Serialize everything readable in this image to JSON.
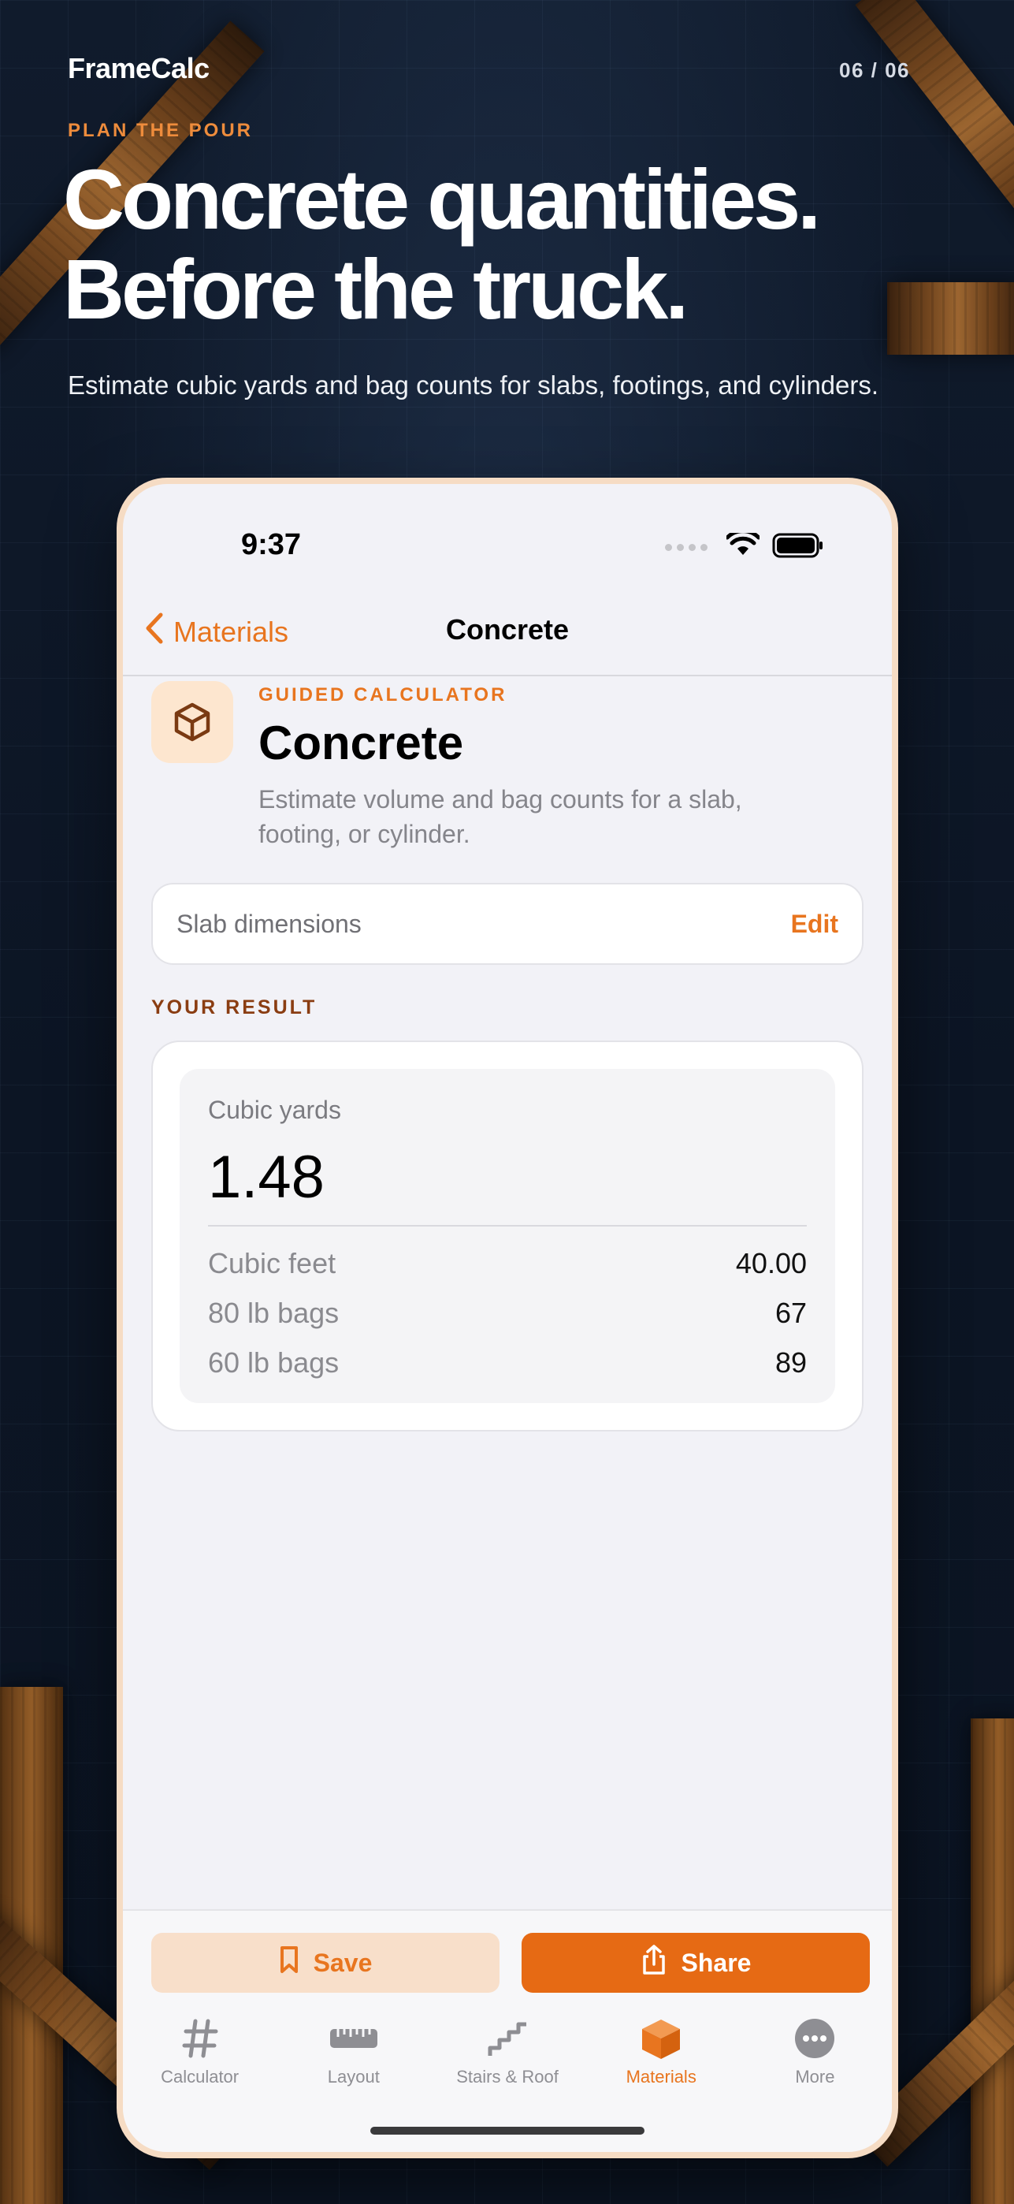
{
  "promo": {
    "brand": "FrameCalc",
    "counter": "06 / 06",
    "eyebrow": "PLAN THE POUR",
    "headline_line1": "Concrete quantities.",
    "headline_line2": "Before the truck.",
    "subline": "Estimate cubic yards and bag counts for slabs, footings, and cylinders."
  },
  "status_bar": {
    "time": "9:37"
  },
  "nav": {
    "back_label": "Materials",
    "title": "Concrete"
  },
  "hero": {
    "eyebrow": "GUIDED CALCULATOR",
    "title": "Concrete",
    "description": "Estimate volume and bag counts for a slab, footing, or cylinder.",
    "icon": "cube-icon"
  },
  "dimensions": {
    "label": "Slab dimensions",
    "edit_label": "Edit"
  },
  "result": {
    "section_label": "YOUR RESULT",
    "primary_label": "Cubic yards",
    "primary_value": "1.48",
    "rows": [
      {
        "label": "Cubic feet",
        "value": "40.00"
      },
      {
        "label": "80 lb bags",
        "value": "67"
      },
      {
        "label": "60 lb bags",
        "value": "89"
      }
    ]
  },
  "actions": {
    "save_label": "Save",
    "share_label": "Share"
  },
  "tabs": [
    {
      "label": "Calculator",
      "icon": "hash-icon"
    },
    {
      "label": "Layout",
      "icon": "ruler-icon"
    },
    {
      "label": "Stairs & Roof",
      "icon": "stairs-icon"
    },
    {
      "label": "Materials",
      "icon": "box-icon",
      "active": true
    },
    {
      "label": "More",
      "icon": "more-icon"
    }
  ],
  "colors": {
    "accent": "#e8751f",
    "accent_soft": "#f8dfca",
    "section_label": "#8a3d12",
    "background_dark": "#0e1726"
  }
}
